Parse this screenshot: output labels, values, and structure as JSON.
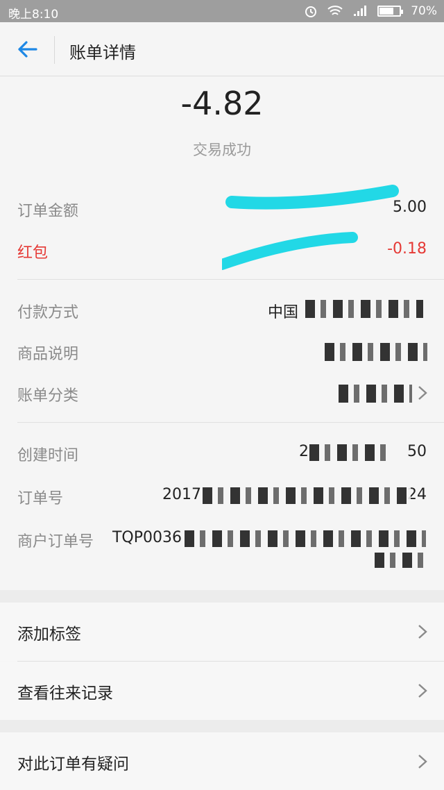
{
  "status": {
    "time": "晚上8:10",
    "battery": "70%",
    "battery_level": 0.7
  },
  "header": {
    "title": "账单详情"
  },
  "summary": {
    "amount": "-4.82",
    "state": "交易成功"
  },
  "amounts": {
    "order_label": "订单金额",
    "order_value": "5.00",
    "redpacket_label": "红包",
    "redpacket_value": "-0.18"
  },
  "details": {
    "payment_label": "付款方式",
    "payment_value": "中国",
    "goods_label": "商品说明",
    "category_label": "账单分类"
  },
  "order": {
    "created_label": "创建时间",
    "created_prefix": "2",
    "created_suffix": "50",
    "order_no_label": "订单号",
    "order_no_prefix": "2017",
    "order_no_suffix": "24",
    "merchant_label": "商户订单号",
    "merchant_prefix": "TQP0036"
  },
  "menu": [
    {
      "label": "添加标签"
    },
    {
      "label": "查看往来记录"
    },
    {
      "label": "对此订单有疑问"
    }
  ],
  "colors": {
    "accent": "#1e88e5",
    "red": "#e53935",
    "highlight": "#22d8e6"
  },
  "icons": {
    "back": "arrow-left-icon",
    "chevron": "chevron-right-icon"
  }
}
